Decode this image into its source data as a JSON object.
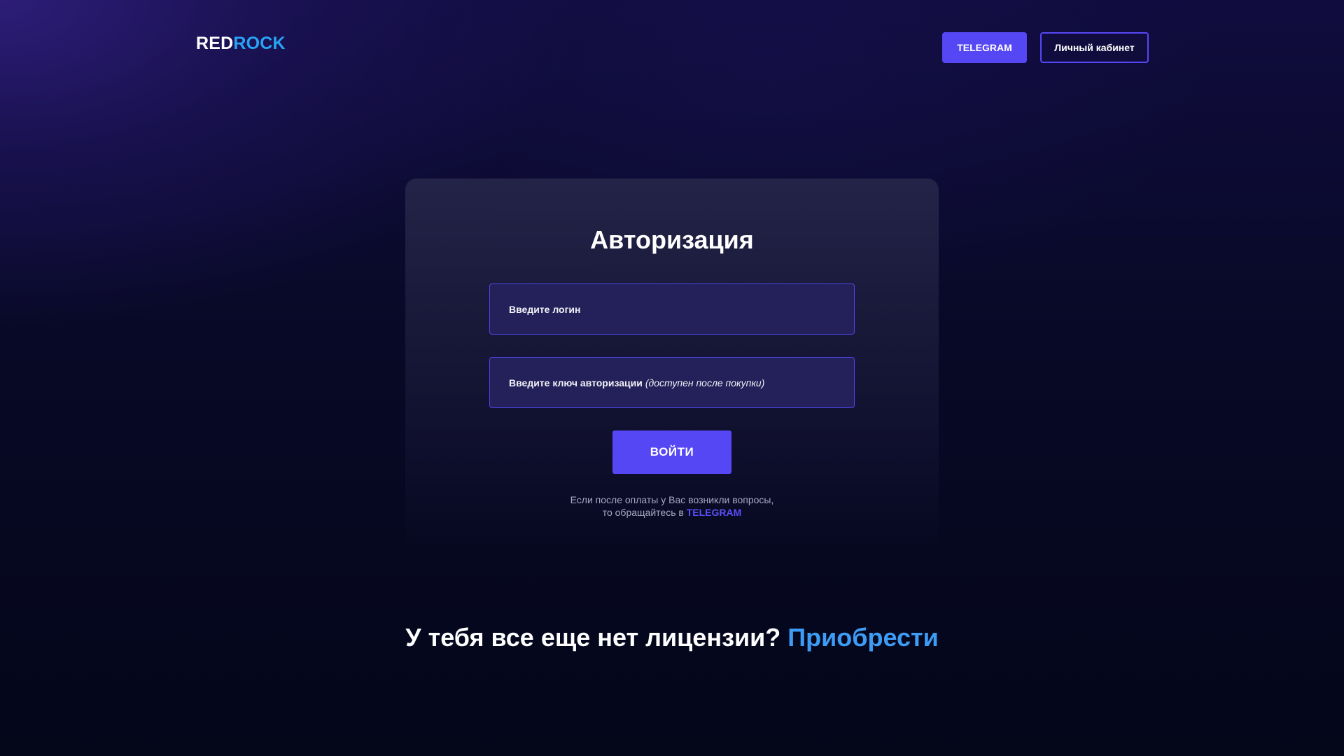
{
  "header": {
    "logo_part1": "RED",
    "logo_part2": "ROCK",
    "telegram_label": "TELEGRAM",
    "cabinet_label": "Личный кабинет"
  },
  "auth": {
    "title": "Авторизация",
    "login_placeholder": "Введите логин",
    "key_placeholder": "Введите ключ авторизации",
    "key_hint": "(доступен после покупки)",
    "submit_label": "ВОЙТИ",
    "note_line1": "Если после оплаты у Вас возникли вопросы,",
    "note_line2": "то обращайтесь в",
    "note_link": "TELEGRAM"
  },
  "cta": {
    "question": "У тебя все еще нет лицензии?",
    "link": "Приобрести"
  },
  "colors": {
    "accent": "#5647f5",
    "logo_blue": "#29a3f5",
    "cta_blue": "#3d9cf5",
    "background": "#05061a"
  }
}
